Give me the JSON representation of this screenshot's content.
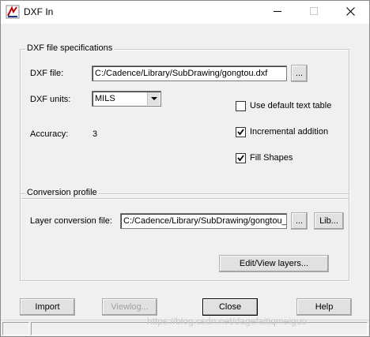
{
  "window": {
    "title": "DXF In",
    "controls": {
      "minimize_icon": "minimize-icon",
      "maximize_icon": "maximize-icon",
      "close_icon": "close-icon"
    }
  },
  "dxf_spec": {
    "legend": "DXF file specifications",
    "file_label": "DXF file:",
    "file_value": "C:/Cadence/Library/SubDrawing/gongtou.dxf",
    "browse_label": "...",
    "units_label": "DXF units:",
    "units_value": "MILS",
    "accuracy_label": "Accuracy:",
    "accuracy_value": "3",
    "options": [
      {
        "label": "Use default text table",
        "checked": false
      },
      {
        "label": "Incremental addition",
        "checked": true
      },
      {
        "label": "Fill Shapes",
        "checked": true
      }
    ]
  },
  "conversion": {
    "legend": "Conversion profile",
    "layer_file_label": "Layer conversion file:",
    "layer_file_value": "C:/Cadence/Library/SubDrawing/gongtou_",
    "browse_label": "...",
    "lib_label": "Lib...",
    "edit_layers_label": "Edit/View layers..."
  },
  "buttons": {
    "import": "Import",
    "viewlog": "Viewlog...",
    "close": "Close",
    "help": "Help"
  },
  "watermark": "https://blog.csdn.net/dagefaitiqmeiguo"
}
